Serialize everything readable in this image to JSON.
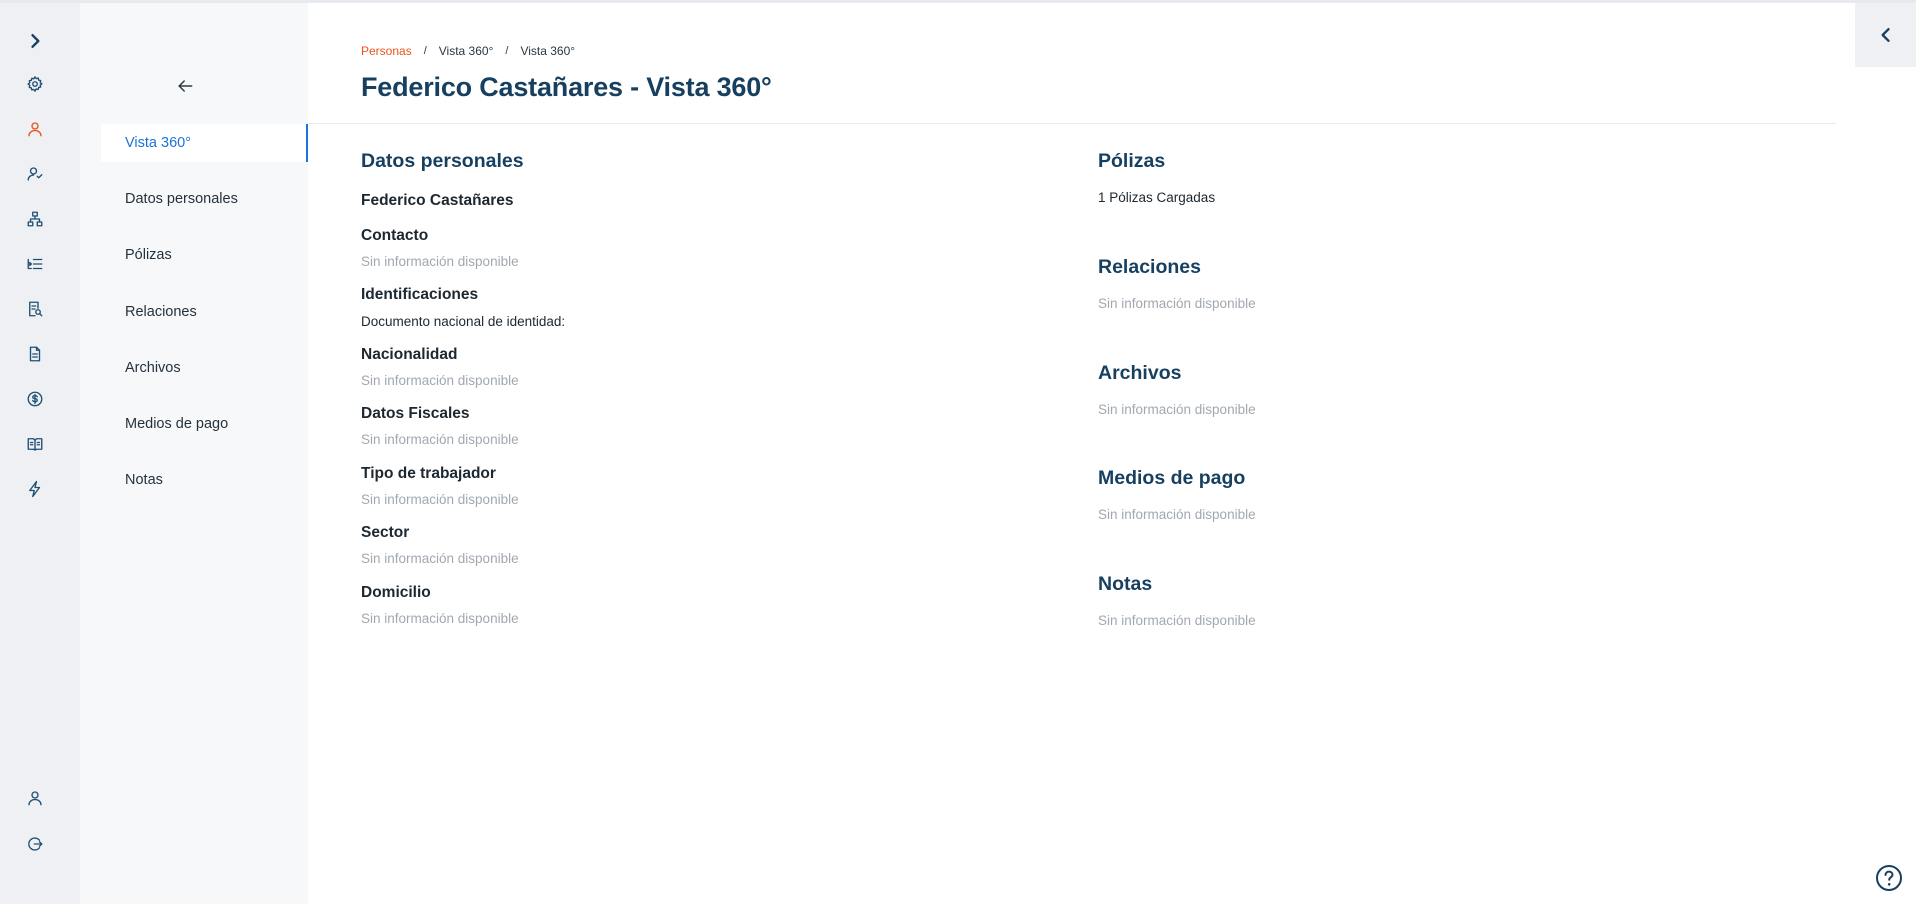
{
  "rail": {
    "items": [
      {
        "name": "expand-icon"
      },
      {
        "name": "gear-icon"
      },
      {
        "name": "person-icon"
      },
      {
        "name": "people-icon"
      },
      {
        "name": "org-chart-icon"
      },
      {
        "name": "flow-icon"
      },
      {
        "name": "report-icon"
      },
      {
        "name": "document-icon"
      },
      {
        "name": "dollar-icon"
      },
      {
        "name": "book-icon"
      },
      {
        "name": "lightning-icon"
      },
      {
        "name": "user-profile-icon"
      },
      {
        "name": "logout-icon"
      }
    ],
    "active_color": "#e8541f",
    "icon_color": "#1f4f73"
  },
  "subnav": {
    "items": [
      {
        "label": "Vista 360°",
        "active": true
      },
      {
        "label": "Datos personales"
      },
      {
        "label": "Pólizas"
      },
      {
        "label": "Relaciones"
      },
      {
        "label": "Archivos"
      },
      {
        "label": "Medios de pago"
      },
      {
        "label": "Notas"
      }
    ]
  },
  "breadcrumb": {
    "items": [
      "Personas",
      "Vista 360°",
      "Vista 360°"
    ],
    "separator": "/"
  },
  "page": {
    "title": "Federico Castañares - Vista 360°"
  },
  "left": {
    "title": "Datos personales",
    "name": "Federico Castañares",
    "sections": [
      {
        "label": "Contacto",
        "value": "Sin información disponible"
      },
      {
        "label": "Identificaciones",
        "value": "Documento nacional de identidad:"
      },
      {
        "label": "Nacionalidad",
        "value": "Sin información disponible"
      },
      {
        "label": "Datos Fiscales",
        "value": "Sin información disponible"
      },
      {
        "label": "Tipo de trabajador",
        "value": "Sin información disponible"
      },
      {
        "label": "Sector",
        "value": "Sin información disponible"
      },
      {
        "label": "Domicilio",
        "value": "Sin información disponible"
      }
    ]
  },
  "right": {
    "sections": [
      {
        "title": "Pólizas",
        "value": "1 Pólizas Cargadas"
      },
      {
        "title": "Relaciones",
        "value": "Sin información disponible"
      },
      {
        "title": "Archivos",
        "value": "Sin información disponible"
      },
      {
        "title": "Medios de pago",
        "value": "Sin información disponible"
      },
      {
        "title": "Notas",
        "value": "Sin información disponible"
      }
    ]
  },
  "colors": {
    "heading": "#173f5f",
    "accent": "#e8541f",
    "active_nav": "#1a73d9",
    "muted_text": "#a1a8b0"
  }
}
